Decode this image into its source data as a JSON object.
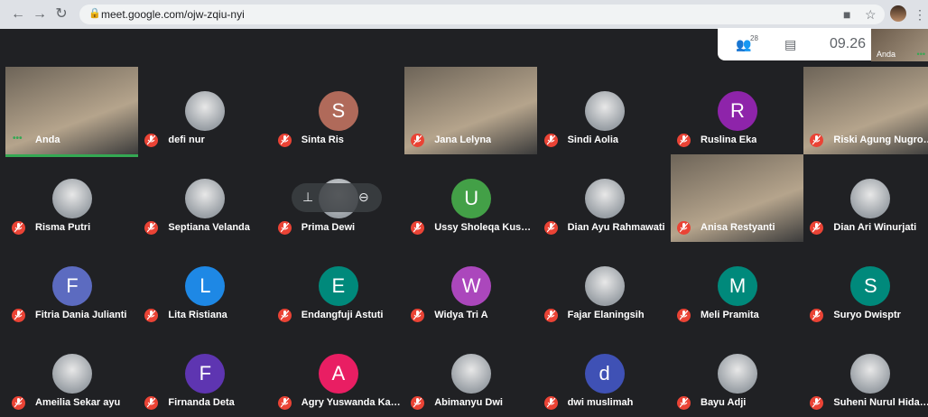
{
  "browser": {
    "url": "meet.google.com/ojw-zqiu-nyi"
  },
  "meet": {
    "participants_count": "28",
    "time": "09.26",
    "self_label": "Anda"
  },
  "colors": {
    "red": "#ea4335",
    "green": "#34a853"
  },
  "tiles": [
    {
      "name": "Anda",
      "kind": "video",
      "letter": ""
    },
    {
      "name": "defi nur",
      "kind": "photo",
      "letter": ""
    },
    {
      "name": "Sinta Ris",
      "kind": "letter",
      "letter": "S",
      "color": "#b06a5a"
    },
    {
      "name": "Jana Lelyna",
      "kind": "video",
      "letter": ""
    },
    {
      "name": "Sindi Aolia",
      "kind": "photo",
      "letter": ""
    },
    {
      "name": "Ruslina Eka",
      "kind": "letter",
      "letter": "R",
      "color": "#8e24aa"
    },
    {
      "name": "Riski Agung Nugroho",
      "kind": "video",
      "letter": ""
    },
    {
      "name": "Risma Putri",
      "kind": "photo",
      "letter": ""
    },
    {
      "name": "Septiana Velanda",
      "kind": "photo",
      "letter": ""
    },
    {
      "name": "Prima Dewi",
      "kind": "photo",
      "letter": ""
    },
    {
      "name": "Ussy Sholeqa Kusuma...",
      "kind": "letter",
      "letter": "U",
      "color": "#43a047"
    },
    {
      "name": "Dian Ayu Rahmawati",
      "kind": "photo",
      "letter": ""
    },
    {
      "name": "Anisa Restyanti",
      "kind": "video",
      "letter": ""
    },
    {
      "name": "Dian Ari Winurjati",
      "kind": "photo",
      "letter": ""
    },
    {
      "name": "Fitria Dania Julianti",
      "kind": "letter",
      "letter": "F",
      "color": "#5c6bc0"
    },
    {
      "name": "Lita Ristiana",
      "kind": "letter",
      "letter": "L",
      "color": "#1e88e5"
    },
    {
      "name": "Endangfuji Astuti",
      "kind": "letter",
      "letter": "E",
      "color": "#00897b"
    },
    {
      "name": "Widya Tri A",
      "kind": "letter",
      "letter": "W",
      "color": "#ab47bc"
    },
    {
      "name": "Fajar Elaningsih",
      "kind": "photo",
      "letter": ""
    },
    {
      "name": "Meli Pramita",
      "kind": "letter",
      "letter": "M",
      "color": "#00897b"
    },
    {
      "name": "Suryo Dwisptr",
      "kind": "letter",
      "letter": "S",
      "color": "#00897b"
    },
    {
      "name": "Ameilia Sekar ayu",
      "kind": "photo",
      "letter": ""
    },
    {
      "name": "Firnanda Deta",
      "kind": "letter",
      "letter": "F",
      "color": "#5e35b1"
    },
    {
      "name": "Agry Yuswanda Karim",
      "kind": "letter",
      "letter": "A",
      "color": "#e91e63"
    },
    {
      "name": "Abimanyu Dwi",
      "kind": "photo",
      "letter": ""
    },
    {
      "name": "dwi muslimah",
      "kind": "letter",
      "letter": "d",
      "color": "#3f51b5"
    },
    {
      "name": "Bayu Adji",
      "kind": "photo",
      "letter": ""
    },
    {
      "name": "Suheni Nurul Hidayah",
      "kind": "photo",
      "letter": ""
    }
  ]
}
